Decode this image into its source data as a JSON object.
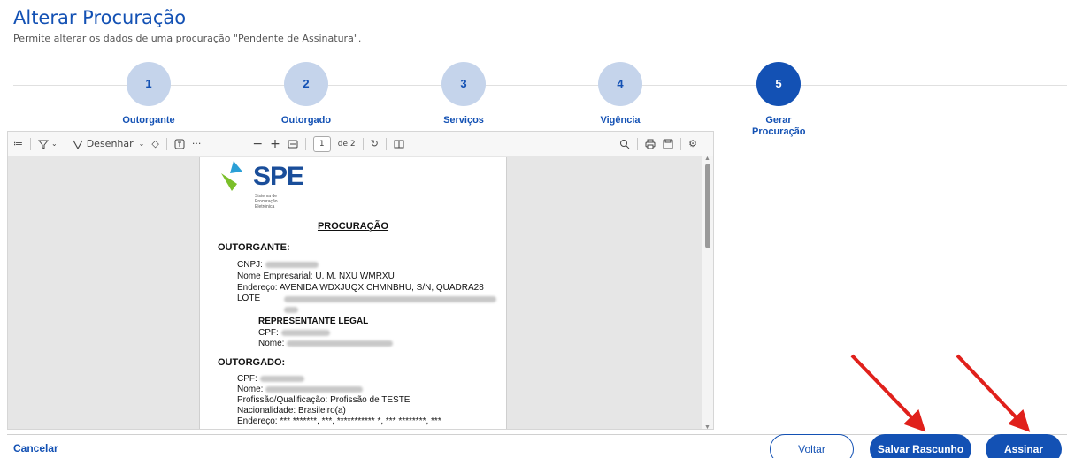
{
  "header": {
    "title": "Alterar Procuração",
    "subtitle": "Permite alterar os dados de uma procuração \"Pendente de Assinatura\"."
  },
  "steps": [
    {
      "number": "1",
      "label": "Outorgante",
      "active": false
    },
    {
      "number": "2",
      "label": "Outorgado",
      "active": false
    },
    {
      "number": "3",
      "label": "Serviços",
      "active": false
    },
    {
      "number": "4",
      "label": "Vigência",
      "active": false
    },
    {
      "number": "5",
      "label": "Gerar Procuração",
      "active": true
    }
  ],
  "toolbar": {
    "draw_label": "Desenhar",
    "minus": "−",
    "plus": "+",
    "page_current": "1",
    "page_total": "de 2"
  },
  "document": {
    "logo_text": "SPE",
    "logo_subtitle": "Sistema de Procuração Eletrônica",
    "title": "PROCURAÇÃO",
    "outorgante_heading": "OUTORGANTE:",
    "cnpj_label": "CNPJ:",
    "nome_empresarial_label": "Nome Empresarial:",
    "nome_empresarial_value": "U. M. NXU WMRXU",
    "endereco_label": "Endereço:",
    "endereco_value": "AVENIDA WDXJUQX CHMNBHU, S/N, QUADRA28 LOTE",
    "representante_heading": "REPRESENTANTE LEGAL",
    "cpf_label": "CPF:",
    "nome_label": "Nome:",
    "outorgado_heading": "OUTORGADO:",
    "profissao_label": "Profissão/Qualificação:",
    "profissao_value": "Profissão de TESTE",
    "nacionalidade_label": "Nacionalidade:",
    "nacionalidade_value": "Brasileiro(a)",
    "endereco2_value": "*** *******, ***, *********** *, *** ********, ***"
  },
  "footer": {
    "cancel_label": "Cancelar",
    "back_label": "Voltar",
    "draft_label": "Salvar Rascunho",
    "sign_label": "Assinar"
  },
  "colors": {
    "primary": "#1351b4",
    "step_inactive": "#c5d4eb",
    "annotation_arrow": "#e0201b"
  }
}
